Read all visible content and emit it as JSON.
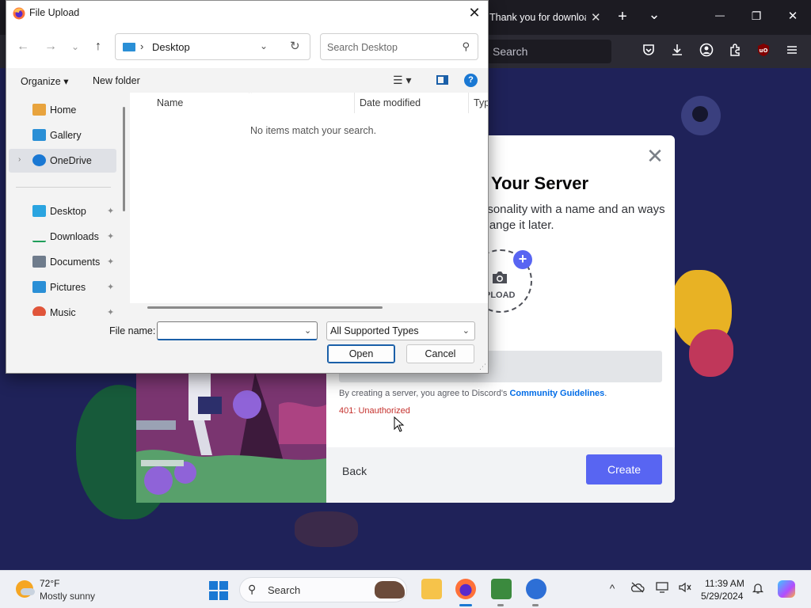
{
  "browser": {
    "tab_title": "Thank you for downloa",
    "tab_close": "✕",
    "new_tab": "+",
    "tab_list": "⌄",
    "minimize": "—",
    "restore": "❐",
    "close": "✕",
    "url_placeholder": "Search"
  },
  "discord": {
    "modal_title": "e Your Server",
    "modal_desc": "ersonality with a name and an ways change it later.",
    "close_glyph": "✕",
    "upload_plus": "+",
    "upload_label": "PLOAD",
    "terms_prefix": "By creating a server, you agree to Discord's ",
    "terms_link": "Community Guidelines",
    "terms_suffix": ".",
    "error": "401: Unauthorized",
    "back": "Back",
    "create": "Create",
    "accent": "#5865f2"
  },
  "dialog": {
    "title": "File Upload",
    "close_glyph": "✕",
    "back_glyph": "←",
    "forward_glyph": "→",
    "recent_glyph": "⌄",
    "up_glyph": "↑",
    "address_sep": "›",
    "address": "Desktop",
    "address_dd": "⌄",
    "refresh_glyph": "↻",
    "search_placeholder": "Search Desktop",
    "search_glyph": "⚲",
    "organize": "Organize ▾",
    "new_folder": "New folder",
    "view_glyph": "☰ ▾",
    "help_glyph": "?",
    "nav_items": [
      {
        "label": "Home",
        "icon": "home-icon",
        "color": "#e8a33d"
      },
      {
        "label": "Gallery",
        "icon": "gallery-icon",
        "color": "#2a8fd6"
      },
      {
        "label": "OneDrive",
        "icon": "cloud-icon",
        "color": "#1a78d3",
        "expand": "›"
      },
      {
        "label": "Desktop",
        "icon": "desktop-icon",
        "color": "#2aa4e0",
        "pin": "📌"
      },
      {
        "label": "Downloads",
        "icon": "download-icon",
        "color": "#1f9e5a",
        "pin": "📌"
      },
      {
        "label": "Documents",
        "icon": "document-icon",
        "color": "#6f7c8c",
        "pin": "📌"
      },
      {
        "label": "Pictures",
        "icon": "picture-icon",
        "color": "#2a8fd6",
        "pin": "📌"
      },
      {
        "label": "Music",
        "icon": "music-icon",
        "color": "#e0553a",
        "pin": "📌"
      }
    ],
    "columns": [
      "Name",
      "Date modified",
      "Type"
    ],
    "sort_glyph": "⌃",
    "empty_message": "No items match your search.",
    "filename_label": "File name:",
    "filename_value": "",
    "filename_dd": "⌄",
    "filetype": "All Supported Types",
    "filetype_dd": "⌄",
    "open": "Open",
    "cancel": "Cancel",
    "grip": "⋰"
  },
  "taskbar": {
    "temp": "72°F",
    "weather": "Mostly sunny",
    "search": "Search",
    "search_glyph": "⚲",
    "tray_chevron": "^",
    "time": "11:39 AM",
    "date": "5/29/2024"
  }
}
